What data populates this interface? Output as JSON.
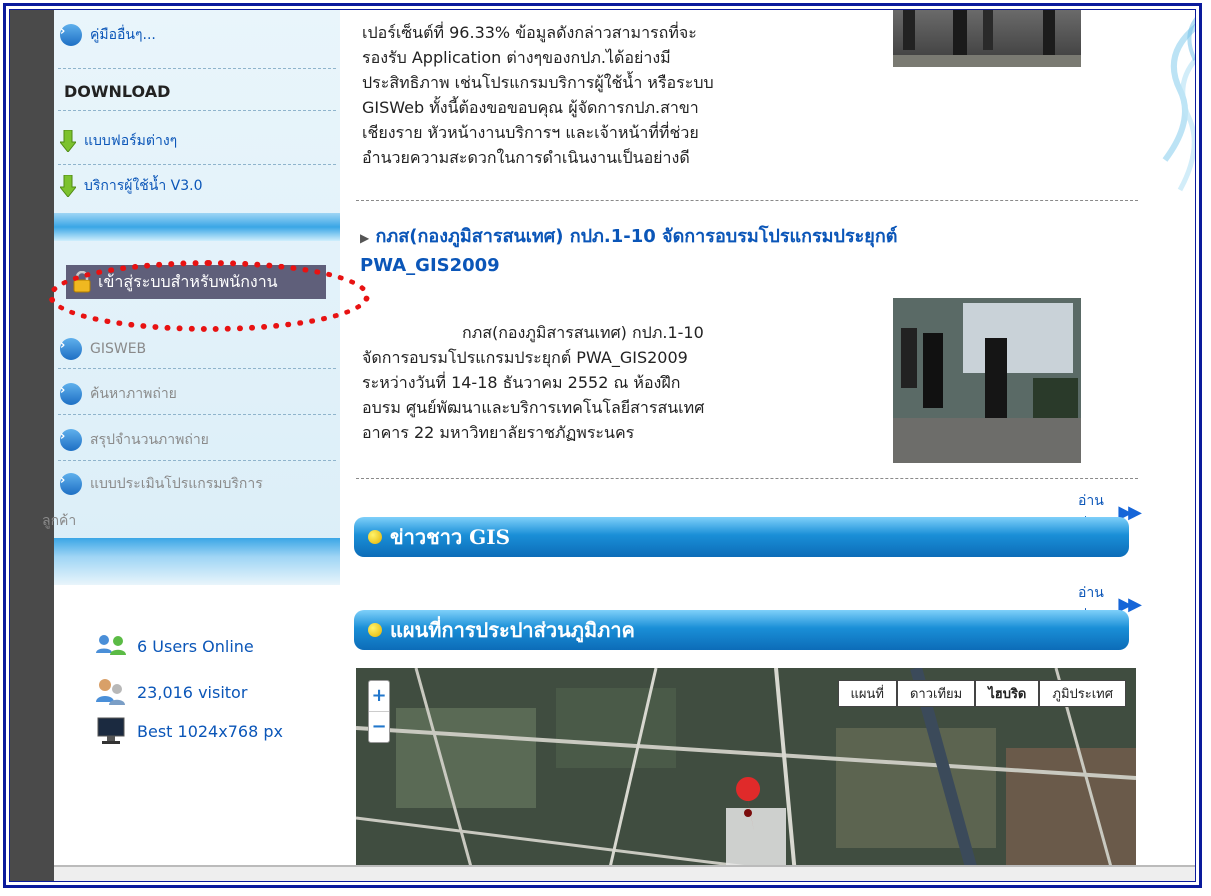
{
  "sidebar": {
    "top_item": "คู่มืออื่นๆ...",
    "download_heading": "DOWNLOAD",
    "download_items": [
      "แบบฟอร์มต่างๆ",
      "บริการผู้ใช้น้ำ V3.0"
    ],
    "login_label": "เข้าสู่ระบบสำหรับพนักงาน",
    "staff_items": [
      "GISWEB",
      "ค้นหาภาพถ่าย",
      "สรุปจำนวนภาพถ่าย"
    ],
    "eval_item": {
      "line1": "แบบประเมินโปรแกรมบริการ",
      "line2": "ลูกค้า"
    },
    "stats": {
      "online": "6 Users Online",
      "visitors": "23,016 visitor",
      "resolution": "Best 1024x768 px"
    }
  },
  "main": {
    "article1": {
      "lines": [
        "เปอร์เซ็นต์ที่ 96.33% ข้อมูลดังกล่าวสามารถที่จะ",
        "รองรับ Application ต่างๆของกปภ.ได้อย่างมี",
        "ประสิทธิภาพ เช่นโปรแกรมบริการผู้ใช้น้ำ หรือระบบ",
        "GISWeb ทั้งนี้ต้องขอขอบคุณ ผู้จัดการกปภ.สาขา",
        "เชียงราย หัวหน้างานบริการฯ และเจ้าหน้าที่ที่ช่วย",
        "อำนวยความสะดวกในการดำเนินงานเป็นอย่างดี"
      ]
    },
    "article2": {
      "title_line1": "กภส(กองภูมิสารสนเทศ) กปภ.1-10 จัดการอบรมโปรแกรมประยุกต์",
      "title_line2": "PWA_GIS2009",
      "lines": [
        "กภส(กองภูมิสารสนเทศ) กปภ.1-10",
        "จัดการอบรมโปรแกรมประยุกต์ PWA_GIS2009",
        "ระหว่างวันที่ 14-18 ธันวาคม 2552 ณ ห้องฝึก",
        "อบรม ศูนย์พัฒนาและบริการเทคโนโลยีสารสนเทศ",
        "อาคาร 22 มหาวิทยาลัยราชภัฏพระนคร"
      ]
    },
    "read_more": "อ่านต่อ",
    "section_news": "ข่าวชาว GIS",
    "section_map": "แผนที่การประปาส่วนภูมิภาค",
    "map": {
      "tabs": [
        "แผนที่",
        "ดาวเทียม",
        "ไฮบริด",
        "ภูมิประเทศ"
      ],
      "active_tab": "ไฮบริด",
      "zoom_in": "+",
      "zoom_out": "−"
    }
  },
  "colors": {
    "frame": "#0a1a9c",
    "link": "#0b56b8",
    "highlight_oval": "#e81212",
    "bar": "#1a8fd7"
  }
}
